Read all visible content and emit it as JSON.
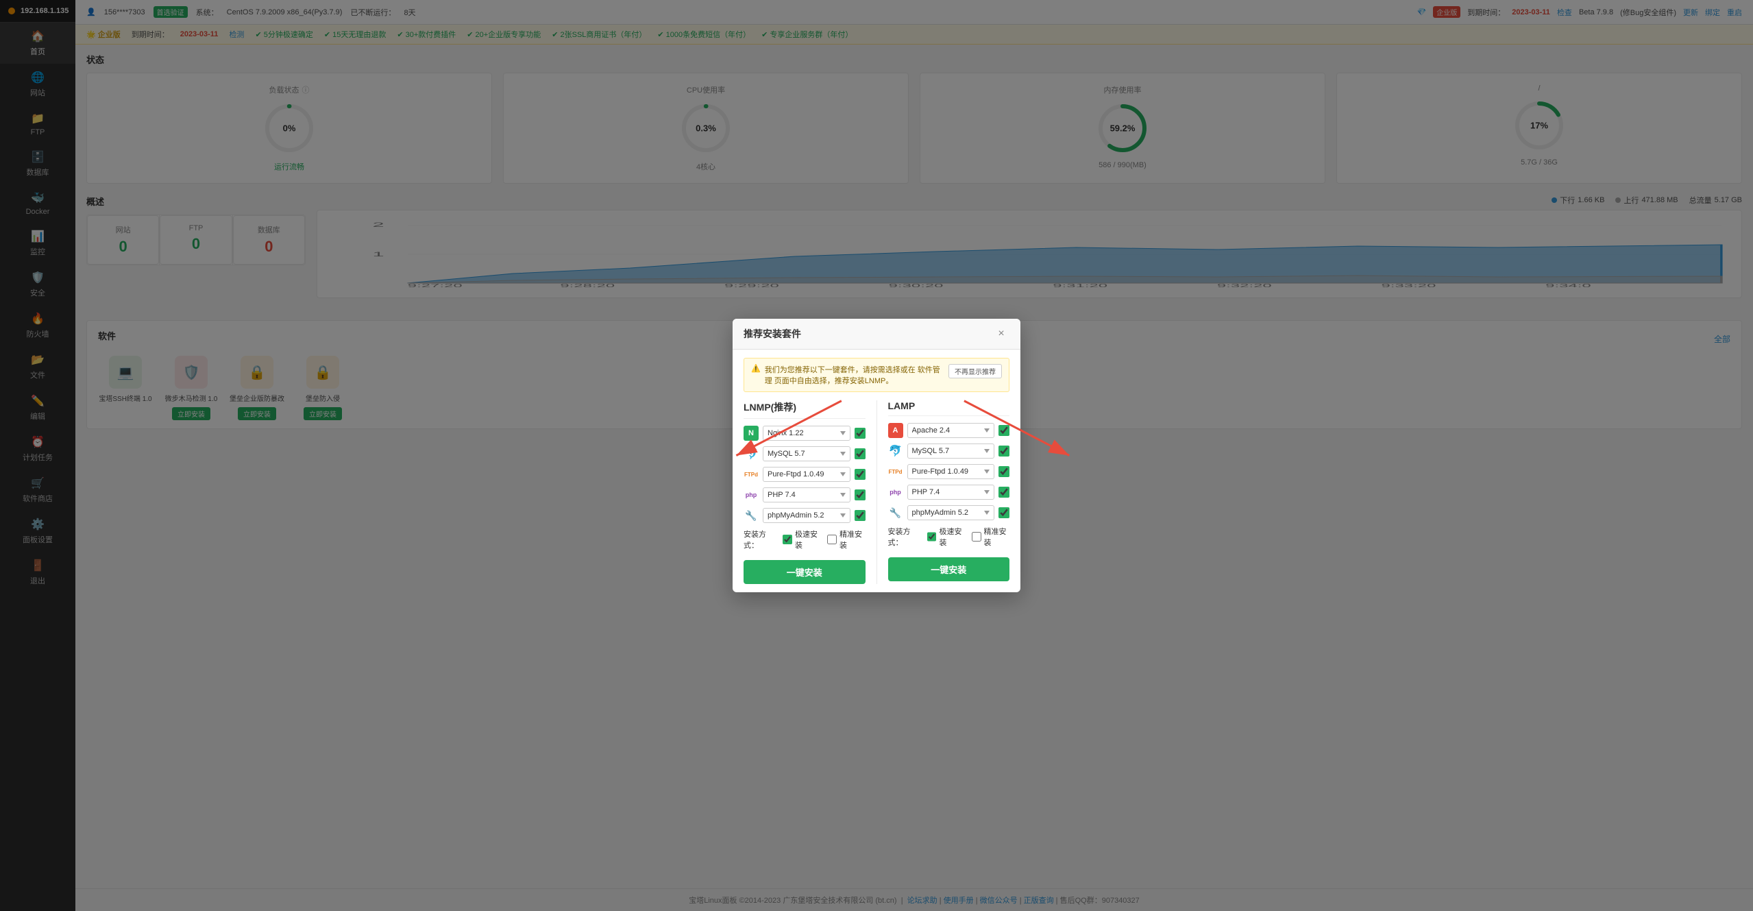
{
  "sidebar": {
    "ip": "192.168.1.135",
    "items": [
      {
        "id": "home",
        "label": "首页",
        "icon": "🏠",
        "active": true
      },
      {
        "id": "website",
        "label": "网站",
        "icon": "🌐"
      },
      {
        "id": "ftp",
        "label": "FTP",
        "icon": "📁"
      },
      {
        "id": "database",
        "label": "数据库",
        "icon": "🗄️"
      },
      {
        "id": "docker",
        "label": "Docker",
        "icon": "🐳"
      },
      {
        "id": "monitor",
        "label": "监控",
        "icon": "📊"
      },
      {
        "id": "security",
        "label": "安全",
        "icon": "🛡️"
      },
      {
        "id": "firewall",
        "label": "防火墙",
        "icon": "🔥"
      },
      {
        "id": "files",
        "label": "文件",
        "icon": "📂"
      },
      {
        "id": "editor",
        "label": "编辑",
        "icon": "✏️"
      },
      {
        "id": "crontab",
        "label": "计划任务",
        "icon": "⏰"
      },
      {
        "id": "appstore",
        "label": "软件商店",
        "icon": "🛒"
      },
      {
        "id": "panel",
        "label": "面板设置",
        "icon": "⚙️"
      },
      {
        "id": "logout",
        "label": "退出",
        "icon": "🚪"
      }
    ]
  },
  "topbar": {
    "user": "156****7303",
    "badge_check": "首选验证",
    "system_label": "系统：",
    "system": "CentOS 7.9.2009 x86_64(Py3.7.9)",
    "uptime_label": "已不断运行：",
    "uptime": "8天",
    "edition_label": "企业版",
    "edition_badge": "企业版",
    "expire_label": "到期时间：",
    "expire_date": "2023-03-11",
    "check_label": "检查",
    "version": "Beta 7.9.8",
    "version_suffix": "(修Bug安全组件)",
    "update_label": "更新",
    "bind_label": "绑定",
    "repeat_label": "重启"
  },
  "enterprise_bar": {
    "edition": "🌟 企业版",
    "expire": "到期时间：",
    "date": "2023-03-11",
    "check": "检测",
    "features": [
      "✔ 5分钟极速确定",
      "✔ 15天无理由退款",
      "✔ 30+款付费插件",
      "✔ 20+企业版专享功能",
      "✔ 2张SSL商用证书（年付）",
      "✔ 1000条免费短信（年付）",
      "✔ 专享企业服务群（年付）"
    ]
  },
  "status_section": {
    "title": "状态",
    "cards": [
      {
        "title": "负载状态",
        "value": "0%",
        "sub": "运行流畅",
        "color": "#27ae60",
        "percent": 0,
        "info": true
      },
      {
        "title": "CPU使用率",
        "value": "0.3%",
        "sub": "4核心",
        "color": "#27ae60",
        "percent": 0.3
      },
      {
        "title": "内存使用率",
        "value": "59.2%",
        "sub": "586 / 990(MB)",
        "color": "#27ae60",
        "percent": 59.2
      },
      {
        "title": "/",
        "value": "17%",
        "sub": "5.7G / 36G",
        "color": "#27ae60",
        "percent": 17
      }
    ]
  },
  "summary_section": {
    "title": "概述",
    "items": [
      {
        "label": "网站",
        "value": "0"
      },
      {
        "label": "FTP",
        "value": "0"
      },
      {
        "label": "数据库",
        "value": "0"
      }
    ]
  },
  "software_section": {
    "title": "软件",
    "filter": "全部",
    "items": [
      {
        "name": "宝塔SSH终端 1.0",
        "icon": "💻",
        "bg": "#e8f4e8",
        "has_btn": false
      },
      {
        "name": "微步木马检测 1.0",
        "icon": "🛡️",
        "bg": "#fde8e8",
        "has_btn": false,
        "btn": "立即安装"
      },
      {
        "name": "堡垒",
        "icon": "🔒",
        "bg": "#e8e8f4",
        "has_btn": true,
        "btn": "立即安装"
      },
      {
        "name": "堡垒企业版防暴改",
        "icon": "🔒",
        "bg": "#e8e8f4",
        "has_btn": true,
        "btn": "立即安装"
      },
      {
        "name": "堡垒防入侵",
        "icon": "🔒",
        "bg": "#e8e8f4",
        "has_btn": true,
        "btn": "立即安装"
      }
    ]
  },
  "network_section": {
    "download_label": "下行",
    "upload_label": "上行",
    "total_label": "总流量",
    "download_value": "1.66 KB",
    "upload_value": "471.88 MB",
    "total_value": "5.17 GB",
    "chart": {
      "time_labels": [
        "9:27:20",
        "9:28:20",
        "9:29:20",
        "9:30:20",
        "9:31:20",
        "9:32:20",
        "9:33:20",
        "9:34:0"
      ],
      "y_max": 2,
      "y_mid": 1
    }
  },
  "modal": {
    "title": "推荐安装套件",
    "notice": "我们为您推荐以下一键套件，请按需选择或在 软件管理 页面中自由选择，推荐安装LNMP。",
    "no_show_btn": "不再显示推荐",
    "close_icon": "×",
    "lnmp": {
      "title": "LNMP(推荐)",
      "fields": [
        {
          "icon": "N",
          "icon_color": "#27ae60",
          "options": [
            "Nginx 1.22"
          ],
          "selected": "Nginx 1.22",
          "checked": true
        },
        {
          "icon": "🐬",
          "icon_color": "#3498db",
          "options": [
            "MySQL 5.7"
          ],
          "selected": "MySQL 5.7",
          "checked": true
        },
        {
          "icon": "FTPd",
          "icon_color": "#e67e22",
          "options": [
            "Pure-Ftpd 1.0.49"
          ],
          "selected": "Pure-Ftpd 1.0.49",
          "checked": true
        },
        {
          "icon": "php",
          "icon_color": "#8e44ad",
          "options": [
            "PHP 7.4"
          ],
          "selected": "PHP 7.4",
          "checked": true
        },
        {
          "icon": "🔧",
          "icon_color": "#e67e22",
          "options": [
            "phpMyAdmin 5.2"
          ],
          "selected": "phpMyAdmin 5.2",
          "checked": true
        }
      ],
      "install_method_label": "安装方式：",
      "fast_label": "极速安装",
      "precise_label": "精准安装",
      "fast_checked": true,
      "precise_checked": false,
      "install_btn": "一键安装"
    },
    "lamp": {
      "title": "LAMP",
      "fields": [
        {
          "icon": "A",
          "icon_color": "#e74c3c",
          "options": [
            "Apache 2.4"
          ],
          "selected": "Apache 2.4",
          "checked": true
        },
        {
          "icon": "🐬",
          "icon_color": "#3498db",
          "options": [
            "MySQL 5.7"
          ],
          "selected": "MySQL 5.7",
          "checked": true
        },
        {
          "icon": "FTPd",
          "icon_color": "#e67e22",
          "options": [
            "Pure-Ftpd 1.0.49"
          ],
          "selected": "Pure-Ftpd 1.0.49",
          "checked": true
        },
        {
          "icon": "php",
          "icon_color": "#8e44ad",
          "options": [
            "PHP 7.4"
          ],
          "selected": "PHP 7.4",
          "checked": true
        },
        {
          "icon": "🔧",
          "icon_color": "#e67e22",
          "options": [
            "phpMyAdmin 5.2"
          ],
          "selected": "phpMyAdmin 5.2",
          "checked": true
        }
      ],
      "install_method_label": "安装方式：",
      "fast_label": "极速安装",
      "precise_label": "精准安装",
      "fast_checked": true,
      "precise_checked": false,
      "install_btn": "一键安装"
    }
  },
  "footer": {
    "text": "宝塔Linux面板 ©2014-2023 广东堡塔安全技术有限公司 (bt.cn)",
    "links": [
      "论坛求助",
      "使用手册",
      "微信公众号",
      "正版查询",
      "售后QQ群：907340327"
    ]
  }
}
